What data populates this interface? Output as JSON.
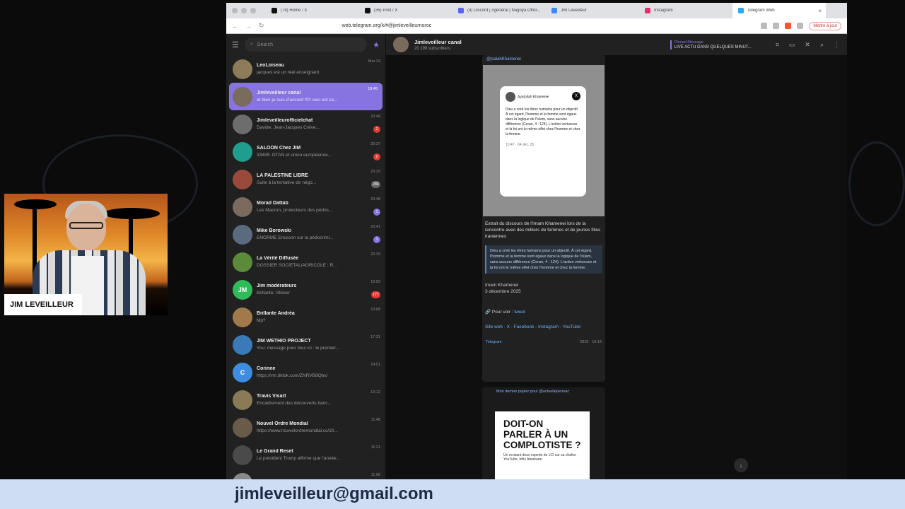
{
  "browser": {
    "tabs": [
      {
        "label": "(78) Home / X",
        "color": "#111111"
      },
      {
        "label": "(35) Post / X",
        "color": "#111111"
      },
      {
        "label": "(4) Discord | #général | Nagoya Offici...",
        "color": "#5865f2"
      },
      {
        "label": "Jim Leveilleur",
        "color": "#4285f4"
      },
      {
        "label": "Instagram",
        "color": "#e1306c"
      },
      {
        "label": "Telegram Web",
        "color": "#2aabee"
      }
    ],
    "url": "web.telegram.org/k/#@jimleveilleurnoroc",
    "update_label": "Mettre à jour"
  },
  "sidebar": {
    "search_placeholder": "Search",
    "chats": [
      {
        "name": "LeoLoiseau",
        "preview": "jacques est un réel enseignant",
        "time": "Mar 24",
        "badge": "",
        "color": "#8d7b5a"
      },
      {
        "name": "Jimleveilleur canal",
        "preview": "et bien je suis d'accord !!!!! ceci est ce...",
        "time": "19:45",
        "badge": "",
        "color": "#7a6c5d"
      },
      {
        "name": "Jimleveilleurofficielchat",
        "preview": "Davide: Jean-Jacques Crève...",
        "time": "20:46",
        "badge": "2",
        "color": "#6d6d6d"
      },
      {
        "name": "SALOON Chez JIM",
        "preview": "33485: OTAN et union européenne...",
        "time": "20:37",
        "badge": "2",
        "color": "#1f9e8f"
      },
      {
        "name": "LA PALESTINE LIBRE",
        "preview": "Suite à la tentative de négo...",
        "time": "20:33",
        "badge": "286",
        "color": "#9a4a3a"
      },
      {
        "name": "Morad Dattab",
        "preview": "Les Macron, protecteurs des pédos...",
        "time": "20:48",
        "badge": "1",
        "color": "#7b6a5e"
      },
      {
        "name": "Mike Borowski",
        "preview": "ENORME Ericsson sur la pédocrimi...",
        "time": "20:41",
        "badge": "1",
        "color": "#5a6b80"
      },
      {
        "name": "La Vérité Diffusée",
        "preview": "DOSSIER SOCIÉTAL/AGRICOLE : R...",
        "time": "20:30",
        "badge": "",
        "color": "#5b8a3a"
      },
      {
        "name": "Jim modérateurs",
        "preview": "Brillante: Sticker",
        "time": "19:59",
        "badge": "177",
        "color": "#2fbb5a",
        "initials": "JM"
      },
      {
        "name": "Brillante Andréa",
        "preview": "Mp?",
        "time": "19:08",
        "badge": "",
        "color": "#a07a4a"
      },
      {
        "name": "JIM WETHIO PROJECT",
        "preview": "You: message pour tous ici : le premier...",
        "time": "17:31",
        "badge": "",
        "color": "#3a7ab8"
      },
      {
        "name": "Corinne",
        "preview": "https://vm.tiktok.com/ZNRVB8Qbs/",
        "time": "14:51",
        "badge": "",
        "color": "#3e8de0",
        "initials": "C"
      },
      {
        "name": "Travis Visart",
        "preview": "Encadrement des découverts banc...",
        "time": "13:12",
        "badge": "",
        "color": "#8a7a55"
      },
      {
        "name": "Nouvel Ordre Mondial",
        "preview": "https://www.nouvelordremondial.cc/20...",
        "time": "11:48",
        "badge": "",
        "color": "#6a5a4a"
      },
      {
        "name": "Le Grand Reset",
        "preview": "Le président Trump affirme que l'année...",
        "time": "11:21",
        "badge": "",
        "color": "#4a4a4a"
      },
      {
        "name": "Fred",
        "preview": "",
        "time": "11:08",
        "badge": "",
        "color": "#888888"
      }
    ]
  },
  "header": {
    "title": "Jimleveilleur canal",
    "subtitle": "20 199 subscribers",
    "pinned_label": "Pinned Message",
    "pinned_text": "LIVE ACTU DANS QUELQUES MINUT..."
  },
  "messages": {
    "forward_source": "@jsalahKhamenei",
    "tweet_author": "Ayatollah Khamenei",
    "tweet_text": "Dieu a créé les êtres humains pour un objectif. À cet égard, l'homme et la femme sont égaux dans la logique de l'Islam, sans aucune différence (Coran, 4 : 124). L'action vertueuse et la foi ont le même effet chez l'homme et chez la femme.",
    "tweet_time": "10:47 · 04 déc. 25",
    "intro": "Extrait du discours de l'Imam Khamenei lors de la rencontre avec des milliers de femmes et de jeunes filles iraniennes",
    "quote": "Dieu a créé les êtres humains pour un objectif. À cet égard, l'homme et la femme sont égaux dans la logique de l'Islam, sans aucune différence (Coran, 4 : 124). L'action vertueuse et la foi ont le même effet chez l'homme et chez la femme.",
    "signature": "Imam Khamenei",
    "date": "3 décembre 2025",
    "see_label": "Pour voir :",
    "tweet_link": "tweet",
    "links": "Site web - X - Facebook - Instagram - YouTube",
    "telegram_label": "Telegram",
    "views": "2818 · 19:14",
    "msg2_head": "Mon dernier papier pour @actuelleperrsac",
    "poster_title": "DOIT-ON PARLER À UN COMPLOTISTE ?",
    "poster_sub": "Un revisant deux experts de LCI sur sa chaîne YouTube, Idris Aberkane"
  },
  "webcam": {
    "name": "JIM LEVEILLEUR"
  },
  "banner": {
    "email": "jimleveilleur@gmail.com"
  }
}
